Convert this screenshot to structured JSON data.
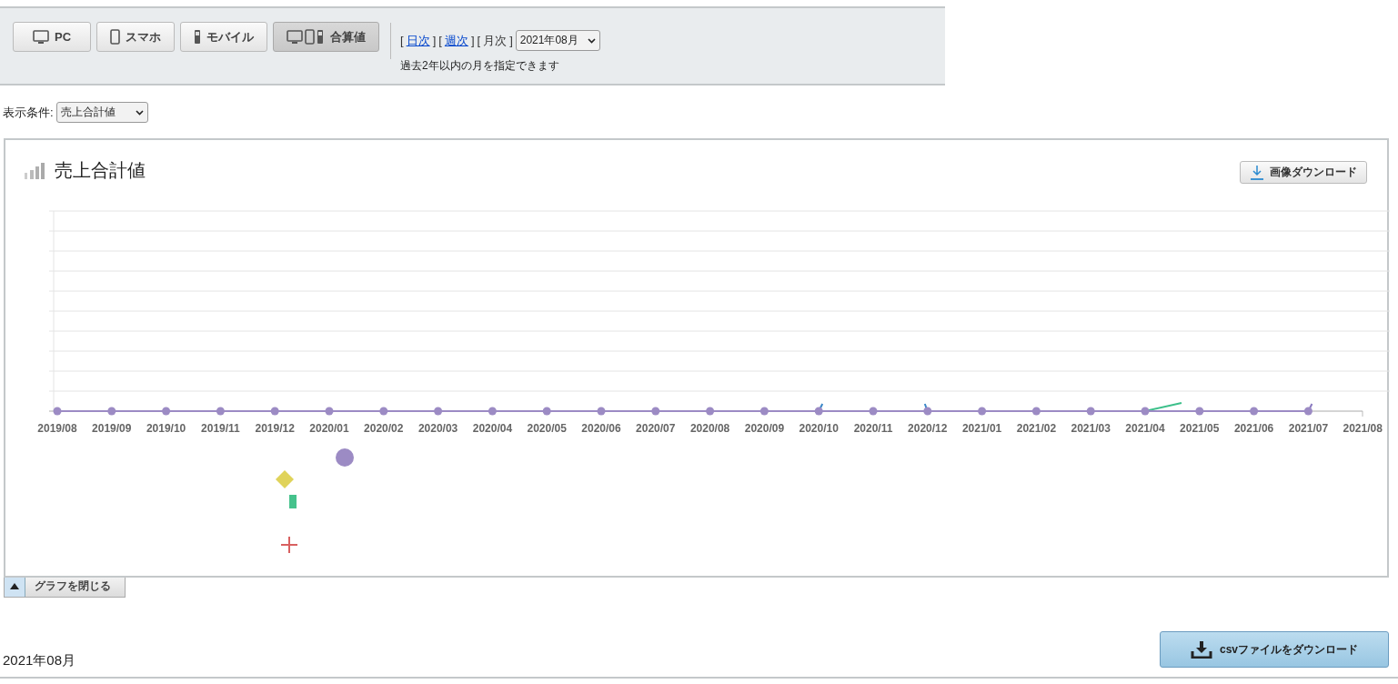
{
  "device_tabs": [
    {
      "kind": "pc",
      "label": "PC",
      "selected": false
    },
    {
      "kind": "smartphone",
      "label": "スマホ",
      "selected": false
    },
    {
      "kind": "mobile",
      "label": "モバイル",
      "selected": false
    },
    {
      "kind": "combined",
      "label": "合算値",
      "selected": true
    }
  ],
  "periods": [
    {
      "open": "[",
      "label": "日次",
      "close": "]",
      "selected": false
    },
    {
      "open": "[",
      "label": "週次",
      "close": "]",
      "selected": false
    },
    {
      "open": "[",
      "label": "月次",
      "close": "]",
      "selected": true
    }
  ],
  "month_select": {
    "value": "2021年08月"
  },
  "period_note": "過去2年以内の月を指定できます",
  "filter": {
    "label": "表示条件:",
    "value": "売上合計値"
  },
  "chart": {
    "title": "売上合計値",
    "download_button": "画像ダウンロード",
    "x_labels": [
      "2019/08",
      "2019/09",
      "2019/10",
      "2019/11",
      "2019/12",
      "2020/01",
      "2020/02",
      "2020/03",
      "2020/04",
      "2020/05",
      "2020/06",
      "2020/07",
      "2020/08",
      "2020/09",
      "2020/10",
      "2020/11",
      "2020/12",
      "2021/01",
      "2021/02",
      "2021/03",
      "2021/04",
      "2021/05",
      "2021/06",
      "2021/07",
      "2021/08"
    ]
  },
  "close_button": "グラフを閉じる",
  "section_date": "2021年08月",
  "csv_button": "csvファイルをダウンロード"
}
